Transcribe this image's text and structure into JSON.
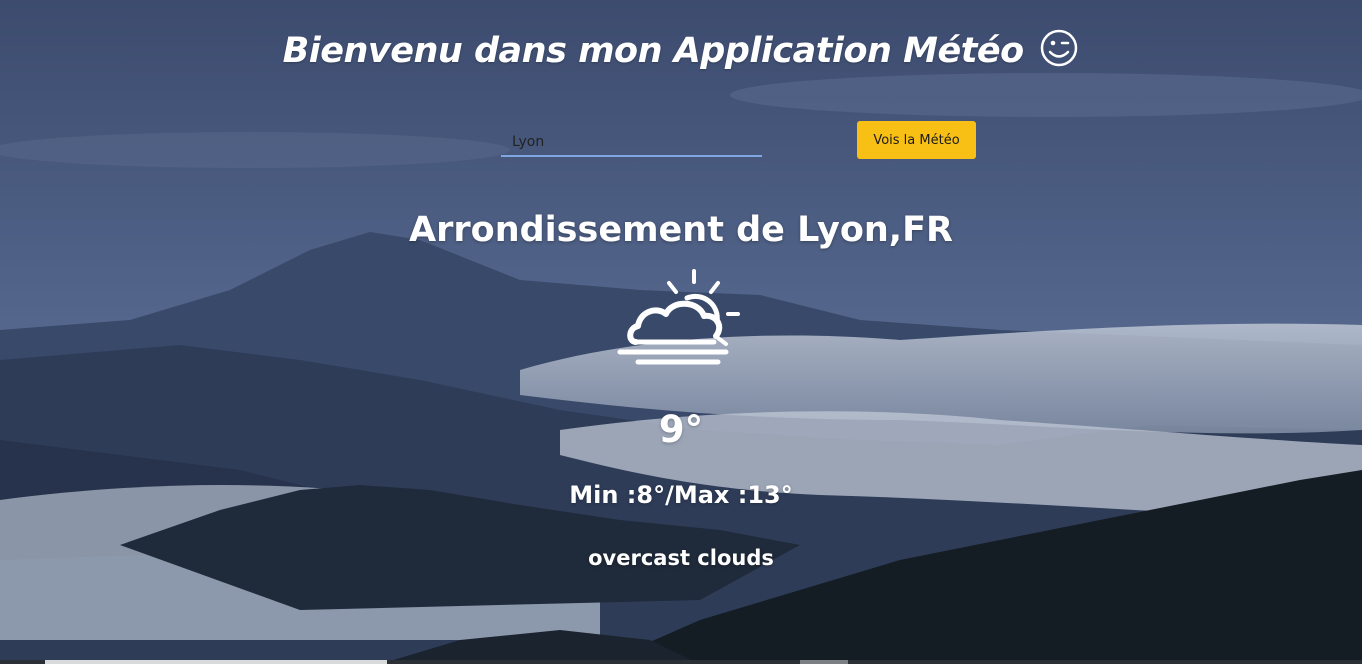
{
  "header": {
    "title": "Bienvenu dans mon Application Météo",
    "title_emoji": "winking-smiley-icon"
  },
  "search": {
    "value": "Lyon",
    "placeholder": "",
    "button_label": "Vois la Météo"
  },
  "weather": {
    "location": "Arrondissement de Lyon,FR",
    "icon": "sun-behind-cloud-fog-icon",
    "temperature": "9°",
    "min_max": "Min :8°/Max :13°",
    "description": "overcast clouds"
  },
  "colors": {
    "button": "#f8bf14",
    "input_underline": "#7fa6e3",
    "text": "#ffffff"
  }
}
